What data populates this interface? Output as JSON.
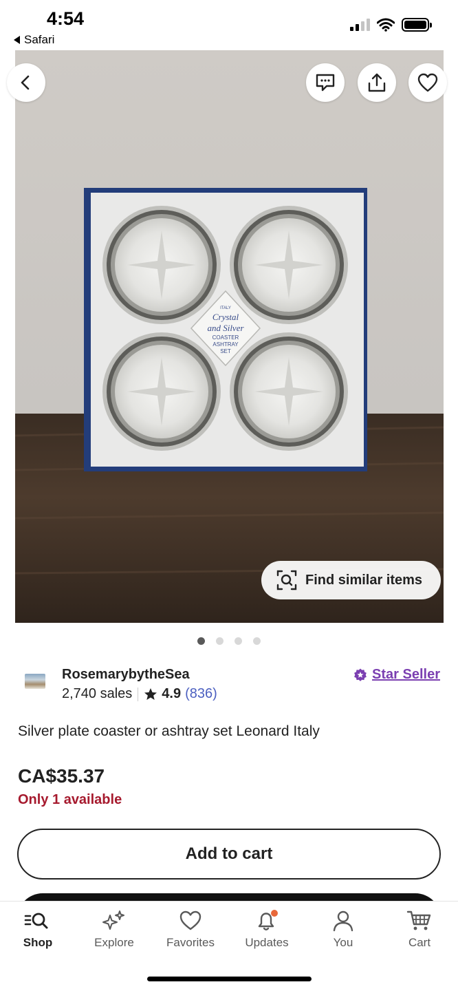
{
  "status_bar": {
    "time": "4:54",
    "back_app": "Safari"
  },
  "product_image": {
    "label_text": [
      "ITALY",
      "Crystal",
      "and Silver",
      "COASTER",
      "ASHTRAY",
      "SET"
    ],
    "find_similar_label": "Find similar items",
    "page_count": 4,
    "active_page": 1
  },
  "seller": {
    "shop_name": "RosemarybytheSea",
    "sales": "2,740 sales",
    "rating": "4.9",
    "review_count": "(836)",
    "badge": "Star Seller"
  },
  "listing": {
    "title": "Silver plate coaster or ashtray set Leonard Italy",
    "price": "CA$35.37",
    "availability": "Only 1 available"
  },
  "actions": {
    "add_to_cart": "Add to cart"
  },
  "tabbar": {
    "tabs": [
      {
        "label": "Shop",
        "icon": "shop-search-icon",
        "active": true
      },
      {
        "label": "Explore",
        "icon": "sparkle-icon",
        "active": false
      },
      {
        "label": "Favorites",
        "icon": "heart-icon",
        "active": false
      },
      {
        "label": "Updates",
        "icon": "bell-icon",
        "active": false,
        "badge": true
      },
      {
        "label": "You",
        "icon": "person-icon",
        "active": false
      },
      {
        "label": "Cart",
        "icon": "cart-icon",
        "active": false
      }
    ]
  },
  "colors": {
    "star_seller": "#7b3fb1",
    "availability": "#a61a2e",
    "review_count": "#4b5fc0",
    "notification_dot": "#e8683a"
  }
}
